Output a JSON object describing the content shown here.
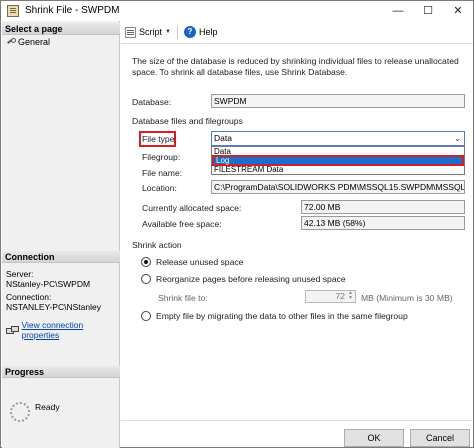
{
  "window": {
    "title": "Shrink File - SWPDM",
    "minimize": "—",
    "maximize": "☐",
    "close": "✕"
  },
  "left": {
    "select_page_header": "Select a page",
    "pages": [
      {
        "label": "General"
      }
    ],
    "connection_header": "Connection",
    "server_label": "Server:",
    "server_value": "NStanley-PC\\SWPDM",
    "connection_label": "Connection:",
    "connection_value": "NSTANLEY-PC\\NStanley",
    "view_props_link": "View connection properties",
    "progress_header": "Progress",
    "progress_status": "Ready"
  },
  "toolbar": {
    "script_label": "Script",
    "help_label": "Help"
  },
  "description": "The size of the database is reduced by shrinking individual files to release unallocated space. To shrink all database files, use Shrink Database.",
  "database": {
    "label": "Database:",
    "value": "SWPDM"
  },
  "files_section": "Database files and filegroups",
  "file_type": {
    "label": "File type:",
    "selected": "Data",
    "options": [
      "Data",
      "Log",
      "FILESTREAM Data"
    ],
    "highlighted_option_index": 1
  },
  "filegroup_label": "Filegroup:",
  "file_name_label": "File name:",
  "location": {
    "label": "Location:",
    "value": "C:\\ProgramData\\SOLIDWORKS PDM\\MSSQL15.SWPDM\\MSSQL\\DATA\\S"
  },
  "allocated": {
    "label": "Currently allocated space:",
    "value": "72.00 MB"
  },
  "free": {
    "label": "Available free space:",
    "value": "42.13 MB (58%)"
  },
  "shrink_action": {
    "header": "Shrink action",
    "release_label": "Release unused space",
    "reorganize_label": "Reorganize pages before releasing unused space",
    "shrink_to_label": "Shrink file to:",
    "shrink_to_value": "72",
    "shrink_to_units": "MB (Minimum is 30 MB)",
    "empty_label": "Empty file by migrating the data to other files in the same filegroup",
    "selected_option": "release"
  },
  "buttons": {
    "ok": "OK",
    "cancel": "Cancel"
  },
  "colors": {
    "accent": "#1b6ed1",
    "highlight_border": "#d32020",
    "link": "#0645ad"
  }
}
